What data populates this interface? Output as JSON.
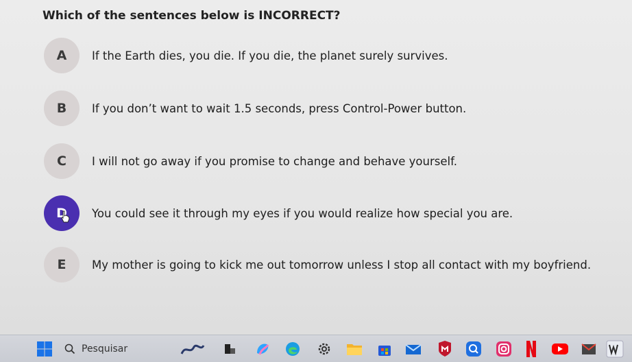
{
  "question": "Which of the sentences below is INCORRECT?",
  "options": [
    {
      "letter": "A",
      "text": "If the Earth dies, you die. If you die, the planet surely survives."
    },
    {
      "letter": "B",
      "text": "If you don’t want to wait 1.5 seconds, press Control-Power button."
    },
    {
      "letter": "C",
      "text": "I will not go away if you promise to change and behave yourself."
    },
    {
      "letter": "D",
      "text": "You could see it through my eyes if you would realize how special you are."
    },
    {
      "letter": "E",
      "text": "My mother is going to kick me out tomorrow unless I stop all contact with my boyfriend."
    }
  ],
  "selected_option": "D",
  "colors": {
    "selected": "#4a2fb0",
    "unselected": "#d8d3d3"
  },
  "taskbar": {
    "search_label": "Pesquisar",
    "icons": [
      "windows-start-icon",
      "search-icon",
      "widgets-icon",
      "task-view-icon",
      "copilot-icon",
      "edge-icon",
      "settings-icon",
      "file-explorer-icon",
      "store-icon",
      "mail-icon",
      "mcafee-icon",
      "magnifier-icon",
      "instagram-icon",
      "netflix-icon",
      "youtube-icon",
      "gmail-icon",
      "word-icon"
    ]
  }
}
